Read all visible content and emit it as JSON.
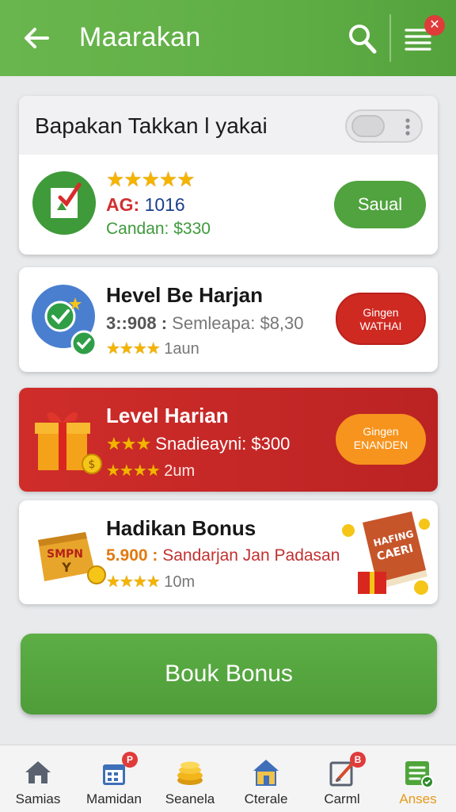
{
  "header": {
    "title": "Maarakan",
    "close_badge": "✕"
  },
  "card1": {
    "title": "Bapakan Takkan l yakai",
    "row": {
      "stars": "★★★★★",
      "line1_prefix": "AG:",
      "line1_value": "1016",
      "line2": "Candan: $330",
      "button": "Saual"
    }
  },
  "card2": {
    "title": "Hevel Be Harjan",
    "line2_prefix": "3::908 :",
    "line2_text": "Semleapa: $8,30",
    "stars": "★★★★",
    "line3_text": "1aun",
    "button": "Gingen\nWATHAI"
  },
  "card3": {
    "title": "Level Harian",
    "stars_top": "★★★",
    "line2_text": "Snadieayni: $300",
    "stars": "★★★★",
    "line3_text": "2um",
    "button": "Gingen\nENANDEN"
  },
  "card4": {
    "title": "Hadikan Bonus",
    "line2_prefix": "5.900 :",
    "line2_text": "Sandarjan Jan Padasan",
    "stars": "★★★★",
    "line3_text": "10m",
    "book_text": "HAFING\nCAERI",
    "bag_text": "SMPN\nY"
  },
  "main_button": "Bouk Bonus",
  "nav": [
    {
      "label": "Samias",
      "icon": "home-icon"
    },
    {
      "label": "Mamidan",
      "icon": "calendar-icon",
      "badge": "P"
    },
    {
      "label": "Seanela",
      "icon": "coins-icon"
    },
    {
      "label": "Cterale",
      "icon": "store-icon"
    },
    {
      "label": "Carml",
      "icon": "edit-icon",
      "badge": "B"
    },
    {
      "label": "Anses",
      "icon": "list-check-icon"
    }
  ],
  "colors": {
    "green": "#5fae45",
    "red": "#cf2d2a",
    "orange": "#f7941d",
    "star": "#f4b400",
    "active_nav": "#e79a17"
  }
}
